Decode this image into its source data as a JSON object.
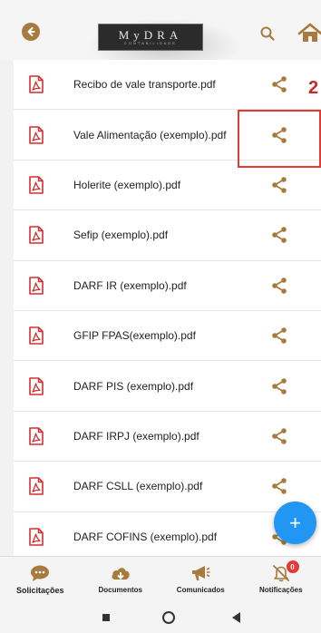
{
  "header": {
    "logo_main": "MyDRA",
    "logo_sub": "CONTABILIDADE"
  },
  "files": [
    {
      "name": "Recibo de vale transporte.pdf"
    },
    {
      "name": "Vale Alimentação (exemplo).pdf"
    },
    {
      "name": "Holerite (exemplo).pdf"
    },
    {
      "name": "Sefip (exemplo).pdf"
    },
    {
      "name": "DARF IR (exemplo).pdf"
    },
    {
      "name": "GFIP FPAS(exemplo).pdf"
    },
    {
      "name": "DARF PIS (exemplo).pdf"
    },
    {
      "name": "DARF IRPJ (exemplo).pdf"
    },
    {
      "name": "DARF CSLL (exemplo).pdf"
    },
    {
      "name": "DARF COFINS (exemplo).pdf"
    }
  ],
  "annotation": {
    "number": "2"
  },
  "fab": {
    "label": "+"
  },
  "bottom_nav": [
    {
      "label": "Solicitações",
      "icon": "chat-icon",
      "active": true
    },
    {
      "label": "Documentos",
      "icon": "cloud-download-icon"
    },
    {
      "label": "Comunicados",
      "icon": "megaphone-icon"
    },
    {
      "label": "Notificações",
      "icon": "bell-off-icon",
      "badge": "0"
    }
  ],
  "colors": {
    "accent": "#a97a3d",
    "pdf_red": "#d32f2f",
    "fab_blue": "#2196f3",
    "annotation_red": "#e53935"
  }
}
